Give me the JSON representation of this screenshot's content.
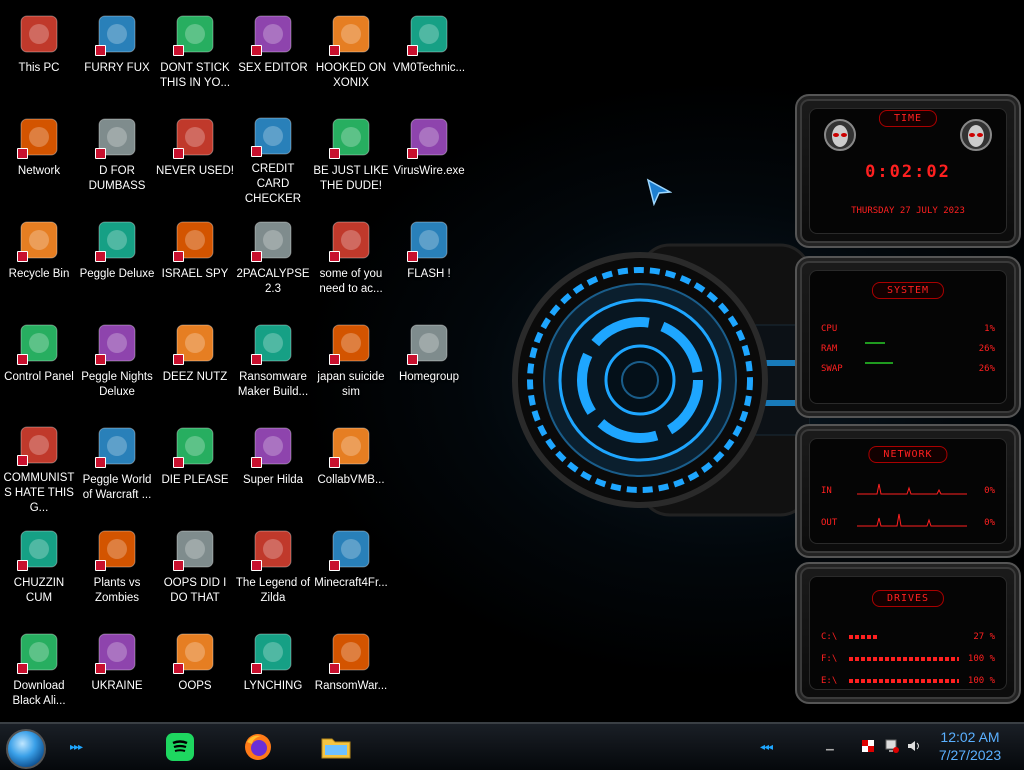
{
  "desktop": {
    "icons": [
      {
        "label": "This PC",
        "x": 0,
        "y": 0
      },
      {
        "label": "FURRY FUX",
        "x": 1,
        "y": 0
      },
      {
        "label": "DONT STICK THIS IN YO...",
        "x": 2,
        "y": 0
      },
      {
        "label": "SEX EDITOR",
        "x": 3,
        "y": 0
      },
      {
        "label": "HOOKED ON XONIX",
        "x": 4,
        "y": 0
      },
      {
        "label": "VM0Technic...",
        "x": 5,
        "y": 0
      },
      {
        "label": "Network",
        "x": 0,
        "y": 1
      },
      {
        "label": "D FOR DUMBASS",
        "x": 1,
        "y": 1
      },
      {
        "label": "NEVER USED!",
        "x": 2,
        "y": 1
      },
      {
        "label": "CREDIT CARD CHECKER",
        "x": 3,
        "y": 1
      },
      {
        "label": "BE JUST LIKE THE DUDE!",
        "x": 4,
        "y": 1
      },
      {
        "label": "VirusWire.exe",
        "x": 5,
        "y": 1
      },
      {
        "label": "Recycle Bin",
        "x": 0,
        "y": 2
      },
      {
        "label": "Peggle Deluxe",
        "x": 1,
        "y": 2
      },
      {
        "label": "ISRAEL SPY",
        "x": 2,
        "y": 2
      },
      {
        "label": "2PACALYPSE 2.3",
        "x": 3,
        "y": 2
      },
      {
        "label": "some of you need to ac...",
        "x": 4,
        "y": 2
      },
      {
        "label": "FLASH !",
        "x": 5,
        "y": 2
      },
      {
        "label": "Control Panel",
        "x": 0,
        "y": 3
      },
      {
        "label": "Peggle Nights Deluxe",
        "x": 1,
        "y": 3
      },
      {
        "label": "DEEZ NUTZ",
        "x": 2,
        "y": 3
      },
      {
        "label": "Ransomware Maker Build...",
        "x": 3,
        "y": 3
      },
      {
        "label": "japan suicide sim",
        "x": 4,
        "y": 3
      },
      {
        "label": "Homegroup",
        "x": 5,
        "y": 3
      },
      {
        "label": "COMMUNISTS HATE THIS G...",
        "x": 0,
        "y": 4
      },
      {
        "label": "Peggle World of Warcraft ...",
        "x": 1,
        "y": 4
      },
      {
        "label": "DIE PLEASE",
        "x": 2,
        "y": 4
      },
      {
        "label": "Super Hilda",
        "x": 3,
        "y": 4
      },
      {
        "label": "CollabVMB...",
        "x": 4,
        "y": 4
      },
      {
        "label": "CHUZZIN CUM",
        "x": 0,
        "y": 5
      },
      {
        "label": "Plants vs Zombies",
        "x": 1,
        "y": 5
      },
      {
        "label": "OOPS DID I DO THAT",
        "x": 2,
        "y": 5
      },
      {
        "label": "The Legend of Zilda",
        "x": 3,
        "y": 5
      },
      {
        "label": "Minecraft4Fr...",
        "x": 4,
        "y": 5
      },
      {
        "label": "Download Black Ali...",
        "x": 0,
        "y": 6
      },
      {
        "label": "UKRAINE",
        "x": 1,
        "y": 6
      },
      {
        "label": "OOPS",
        "x": 2,
        "y": 6
      },
      {
        "label": "LYNCHING",
        "x": 3,
        "y": 6
      },
      {
        "label": "RansomWar...",
        "x": 4,
        "y": 6
      }
    ]
  },
  "widgets": {
    "time": {
      "title": "TIME",
      "clock": "0:02:02",
      "date": "THURSDAY 27 JULY 2023"
    },
    "system": {
      "title": "SYSTEM",
      "rows": [
        {
          "k": "CPU",
          "v": "1%"
        },
        {
          "k": "RAM",
          "v": "26%"
        },
        {
          "k": "SWAP",
          "v": "26%"
        }
      ]
    },
    "network": {
      "title": "NETWORK",
      "rows": [
        {
          "k": "IN",
          "v": "0%"
        },
        {
          "k": "OUT",
          "v": "0%"
        }
      ]
    },
    "drives": {
      "title": "DRIVES",
      "rows": [
        {
          "k": "C:\\",
          "v": "27 %"
        },
        {
          "k": "F:\\",
          "v": "100 %"
        },
        {
          "k": "E:\\",
          "v": "100 %"
        }
      ]
    }
  },
  "taskbar": {
    "time": "12:02 AM",
    "date": "7/27/2023"
  },
  "colors": {
    "accent": "#1ea6ff",
    "alien_red": "#ff2020"
  }
}
